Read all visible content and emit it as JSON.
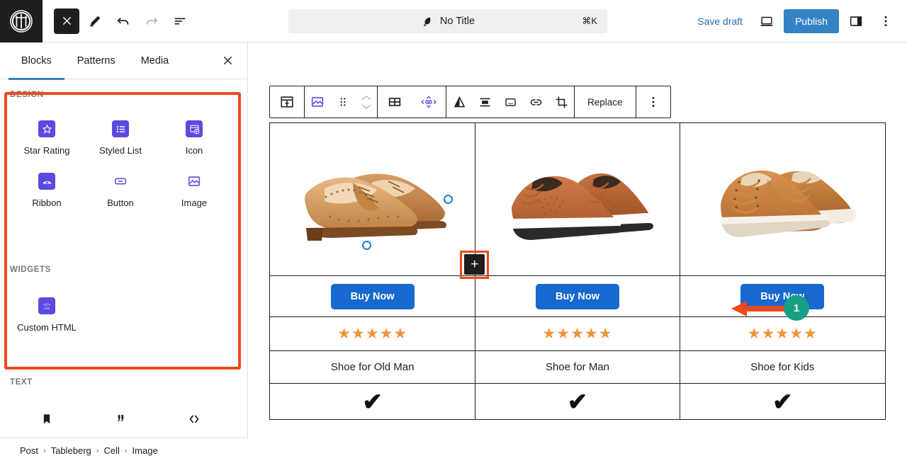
{
  "topbar": {
    "logo_icon": "wordpress-logo-icon",
    "close_icon": "close-icon",
    "edit_icon": "pencil-edit-icon",
    "undo_icon": "undo-icon",
    "redo_icon": "redo-icon",
    "list_view_icon": "document-outline-icon",
    "command_bar": {
      "icon": "feather-icon",
      "title": "No Title",
      "shortcut": "⌘K"
    },
    "save_draft_label": "Save draft",
    "preview_icon": "desktop-preview-icon",
    "publish_label": "Publish",
    "settings_sidebar_icon": "sidebar-panel-icon",
    "options_icon": "more-vertical-icon"
  },
  "sidebar": {
    "tabs": [
      {
        "label": "Blocks",
        "active": true
      },
      {
        "label": "Patterns",
        "active": false
      },
      {
        "label": "Media",
        "active": false
      }
    ],
    "close_icon": "close-icon",
    "highlight_color": "#ec4a1d",
    "categories": [
      {
        "title": "DESIGN",
        "items": [
          {
            "label": "Star Rating",
            "icon": "star-rating-icon",
            "style": "purple"
          },
          {
            "label": "Styled List",
            "icon": "styled-list-icon",
            "style": "purple"
          },
          {
            "label": "Icon",
            "icon": "icon-block-icon",
            "style": "purple"
          },
          {
            "label": "Ribbon",
            "icon": "ribbon-icon",
            "style": "purple"
          },
          {
            "label": "Button",
            "icon": "button-icon",
            "style": "outline"
          },
          {
            "label": "Image",
            "icon": "image-icon",
            "style": "outline"
          }
        ]
      },
      {
        "title": "WIDGETS",
        "items": [
          {
            "label": "Custom HTML",
            "icon": "custom-html-icon",
            "style": "purple"
          }
        ]
      },
      {
        "title": "TEXT",
        "items": [
          {
            "label": "",
            "icon": "paragraph-bookmark-icon",
            "style": "outline"
          },
          {
            "label": "",
            "icon": "quote-icon",
            "style": "outline"
          },
          {
            "label": "",
            "icon": "code-icon",
            "style": "outline"
          }
        ]
      }
    ]
  },
  "breadcrumb": {
    "items": [
      "Post",
      "Tableberg",
      "Cell",
      "Image"
    ],
    "separator": "›"
  },
  "block_toolbar": {
    "buttons": [
      {
        "name": "table-block-icon",
        "label": ""
      },
      {
        "name": "image-block-icon",
        "label": ""
      },
      {
        "name": "drag-handle-icon",
        "label": ""
      },
      {
        "name": "move-up-down-icon",
        "label": ""
      },
      {
        "name": "table-grid-icon",
        "label": ""
      },
      {
        "name": "resize-cell-icon",
        "label": ""
      },
      {
        "name": "filter-duotone-icon",
        "label": ""
      },
      {
        "name": "align-icon",
        "label": ""
      },
      {
        "name": "caption-icon",
        "label": ""
      },
      {
        "name": "link-icon",
        "label": ""
      },
      {
        "name": "crop-icon",
        "label": ""
      }
    ],
    "replace_label": "Replace",
    "more_icon": "more-vertical-icon"
  },
  "product_table": {
    "columns": [
      {
        "image_alt": "brown brogue dress shoes",
        "buy_label": "Buy Now",
        "stars": "★★★★★",
        "rating": 5,
        "name": "Shoe for Old Man",
        "check": "✔"
      },
      {
        "image_alt": "tan casual leather sneakers",
        "buy_label": "Buy Now",
        "stars": "★★★★★",
        "rating": 5,
        "name": "Shoe for Man",
        "check": "✔"
      },
      {
        "image_alt": "light brown lace-up sneakers",
        "buy_label": "Buy Now",
        "stars": "★★★★★",
        "rating": 5,
        "name": "Shoe for Kids",
        "check": "✔"
      }
    ],
    "buy_button_color": "#1669ce",
    "star_color": "#ef9439"
  },
  "annotation": {
    "badge_number": "1",
    "badge_color": "#16a085",
    "arrow_color": "#ec4a1d",
    "target_icon": "add-block-plus-icon",
    "plus_label": "+"
  }
}
